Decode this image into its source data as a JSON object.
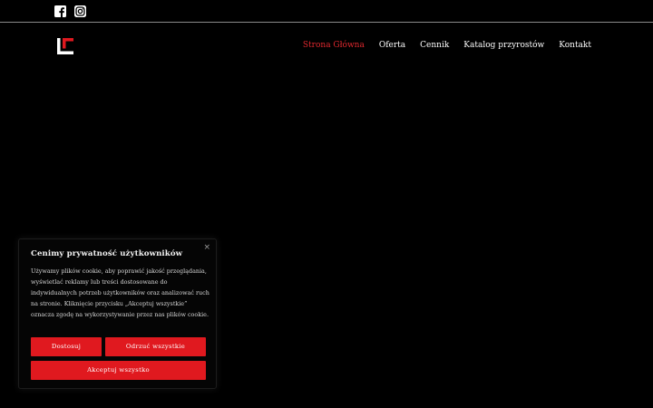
{
  "colors": {
    "background": "#000000",
    "accent": "#e0191f",
    "active_nav": "#e0282e",
    "text": "#ffffff"
  },
  "social": {
    "items": [
      {
        "name": "facebook",
        "icon": "facebook-icon"
      },
      {
        "name": "instagram",
        "icon": "instagram-icon"
      }
    ]
  },
  "header": {
    "logo_icon": "brand-logo-icon",
    "nav": [
      {
        "label": "Strona Główna",
        "active": true
      },
      {
        "label": "Oferta",
        "active": false
      },
      {
        "label": "Cennik",
        "active": false
      },
      {
        "label": "Katalog przyrostów",
        "active": false
      },
      {
        "label": "Kontakt",
        "active": false
      }
    ]
  },
  "cookie": {
    "close_label": "×",
    "title": "Cenimy prywatność użytkowników",
    "text": "Używamy plików cookie, aby poprawić jakość przeglądania, wyświetlać reklamy lub treści dostosowane do indywidualnych potrzeb użytkowników oraz analizować ruch na stronie. Kliknięcie przycisku „Akceptuj wszystkie” oznacza zgodę na wykorzystywanie przez nas plików cookie.",
    "customize_label": "Dostosuj",
    "reject_label": "Odrzuć wszystkie",
    "accept_label": "Akceptuj wszystko"
  }
}
